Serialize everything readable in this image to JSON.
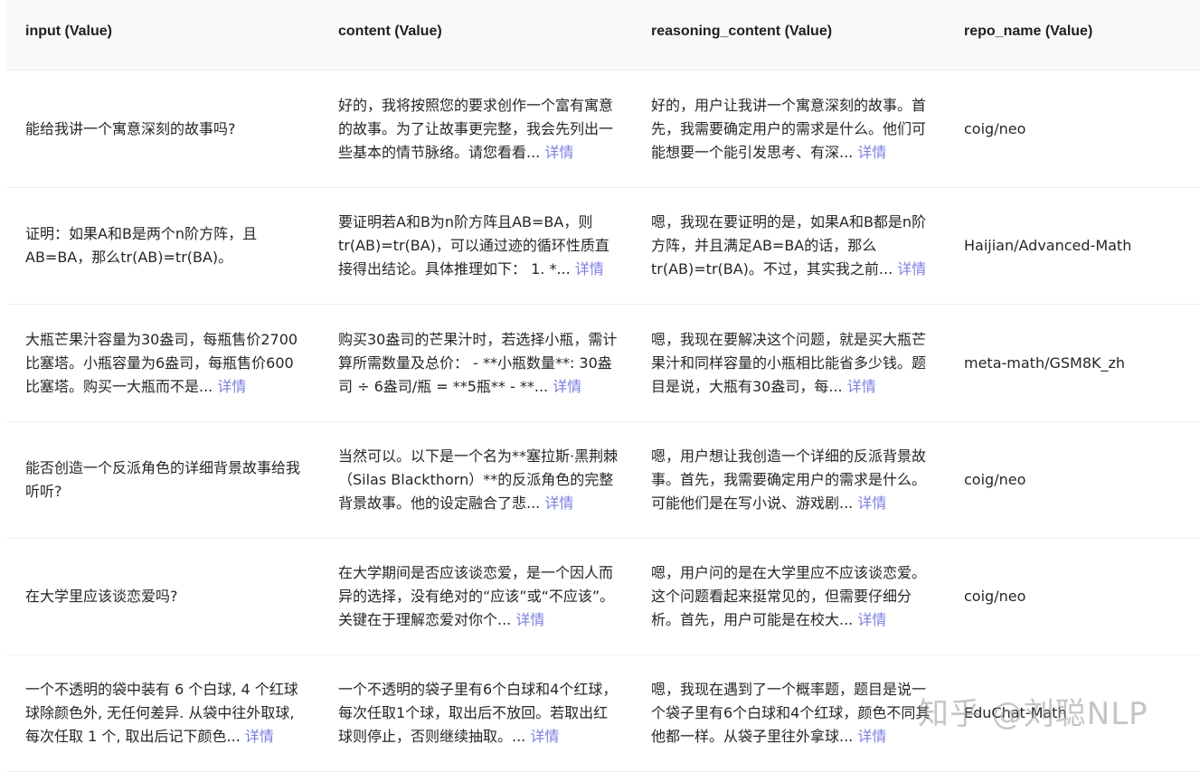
{
  "columns": [
    "input (Value)",
    "content (Value)",
    "reasoning_content (Value)",
    "repo_name (Value)"
  ],
  "more_label": "详情",
  "rows": [
    {
      "input": "能给我讲一个寓意深刻的故事吗?",
      "content": "好的，我将按照您的要求创作一个富有寓意的故事。为了让故事更完整，我会先列出一些基本的情节脉络。请您看看...",
      "reasoning": "好的，用户让我讲一个寓意深刻的故事。首先，我需要确定用户的需求是什么。他们可能想要一个能引发思考、有深...",
      "repo": "coig/neo"
    },
    {
      "input": "证明：如果A和B是两个n阶方阵，且AB=BA，那么tr(AB)=tr(BA)。",
      "content": "要证明若A和B为n阶方阵且AB=BA，则tr(AB)=tr(BA)，可以通过迹的循环性质直接得出结论。具体推理如下： 1. *...",
      "reasoning": "嗯，我现在要证明的是，如果A和B都是n阶方阵，并且满足AB=BA的话，那么tr(AB)=tr(BA)。不过，其实我之前...",
      "repo": "Haijian/Advanced-Math"
    },
    {
      "input": "大瓶芒果汁容量为30盎司，每瓶售价2700比塞塔。小瓶容量为6盎司，每瓶售价600比塞塔。购买一大瓶而不是...",
      "content": "购买30盎司的芒果汁时，若选择小瓶，需计算所需数量及总价： - **小瓶数量**: 30盎司 ÷ 6盎司/瓶 = **5瓶** - **...",
      "reasoning": "嗯，我现在要解决这个问题，就是买大瓶芒果汁和同样容量的小瓶相比能省多少钱。题目是说，大瓶有30盎司，每...",
      "repo": "meta-math/GSM8K_zh"
    },
    {
      "input": "能否创造一个反派角色的详细背景故事给我听听?",
      "content": "当然可以。以下是一个名为**塞拉斯·黑荆棘（Silas Blackthorn）**的反派角色的完整背景故事。他的设定融合了悲...",
      "reasoning": "嗯，用户想让我创造一个详细的反派背景故事。首先，我需要确定用户的需求是什么。可能他们是在写小说、游戏剧...",
      "repo": "coig/neo"
    },
    {
      "input": "在大学里应该谈恋爱吗?",
      "content": "在大学期间是否应该谈恋爱，是一个因人而异的选择，没有绝对的“应该”或“不应该”。关键在于理解恋爱对你个...",
      "reasoning": "嗯，用户问的是在大学里应不应该谈恋爱。这个问题看起来挺常见的，但需要仔细分析。首先，用户可能是在校大...",
      "repo": "coig/neo"
    },
    {
      "input": "一个不透明的袋中装有 6 个白球, 4 个红球球除颜色外, 无任何差异. 从袋中往外取球, 每次任取 1 个, 取出后记下颜色...",
      "content": "一个不透明的袋子里有6个白球和4个红球，每次任取1个球，取出后不放回。若取出红球则停止，否则继续抽取。...",
      "reasoning": "嗯，我现在遇到了一个概率题，题目是说一个袋子里有6个白球和4个红球，颜色不同其他都一样。从袋子里往外拿球...",
      "repo": "EduChat-Math"
    }
  ],
  "watermark": "知乎 @刘聪NLP"
}
